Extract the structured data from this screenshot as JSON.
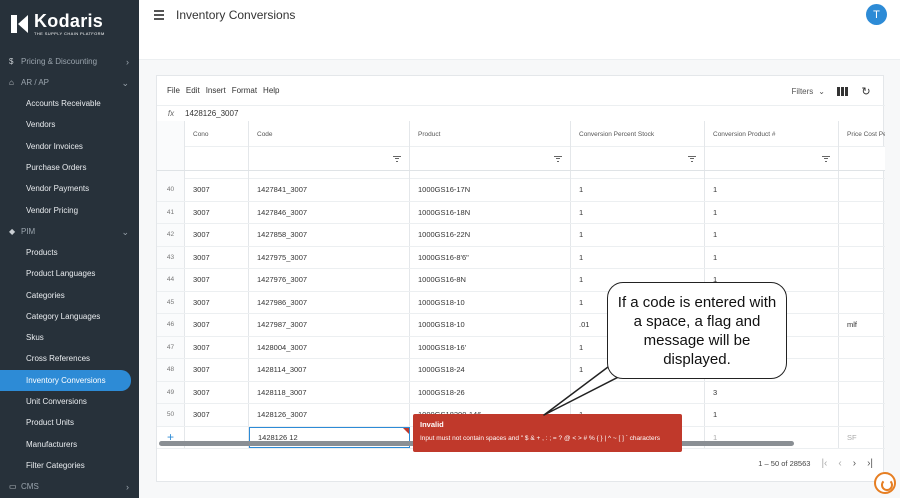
{
  "brand": {
    "name": "Kodaris",
    "tagline": "THE SUPPLY CHAIN PLATFORM"
  },
  "sidebar": {
    "items": [
      {
        "type": "group",
        "icon": "dollar-icon",
        "glyph": "$",
        "label": "Pricing & Discounting",
        "chevron": "›"
      },
      {
        "type": "group",
        "icon": "bank-icon",
        "glyph": "⌂",
        "label": "AR / AP",
        "chevron": "⌄"
      },
      {
        "type": "item",
        "label": "Accounts Receivable"
      },
      {
        "type": "item",
        "label": "Vendors"
      },
      {
        "type": "item",
        "label": "Vendor Invoices"
      },
      {
        "type": "item",
        "label": "Purchase Orders"
      },
      {
        "type": "item",
        "label": "Vendor Payments"
      },
      {
        "type": "item",
        "label": "Vendor Pricing"
      },
      {
        "type": "group",
        "icon": "tag-icon",
        "glyph": "◆",
        "label": "PIM",
        "chevron": "⌄"
      },
      {
        "type": "item",
        "label": "Products"
      },
      {
        "type": "item",
        "label": "Product Languages"
      },
      {
        "type": "item",
        "label": "Categories"
      },
      {
        "type": "item",
        "label": "Category Languages"
      },
      {
        "type": "item",
        "label": "Skus"
      },
      {
        "type": "item",
        "label": "Cross References"
      },
      {
        "type": "item",
        "label": "Inventory Conversions",
        "active": true
      },
      {
        "type": "item",
        "label": "Unit Conversions"
      },
      {
        "type": "item",
        "label": "Product Units"
      },
      {
        "type": "item",
        "label": "Manufacturers"
      },
      {
        "type": "item",
        "label": "Filter Categories"
      },
      {
        "type": "group",
        "icon": "cms-icon",
        "glyph": "▭",
        "label": "CMS",
        "chevron": "›"
      }
    ]
  },
  "header": {
    "title": "Inventory Conversions",
    "avatar_initial": "T"
  },
  "menubar": [
    "File",
    "Edit",
    "Insert",
    "Format",
    "Help"
  ],
  "toolbar": {
    "filters_label": "Filters",
    "filters_chevron": "⌄",
    "refresh_glyph": "↻"
  },
  "formula_bar": {
    "fx": "fx",
    "value": "1428126_3007"
  },
  "columns": [
    "Cono",
    "Code",
    "Product",
    "Conversion Percent Stock",
    "Conversion Product #",
    "Price Cost Per"
  ],
  "rows": [
    {
      "num": "40",
      "cono": "3007",
      "code": "1427841_3007",
      "product": "1000GS16-17N",
      "pct": "1",
      "conv": "1",
      "price": ""
    },
    {
      "num": "41",
      "cono": "3007",
      "code": "1427846_3007",
      "product": "1000GS16-18N",
      "pct": "1",
      "conv": "1",
      "price": ""
    },
    {
      "num": "42",
      "cono": "3007",
      "code": "1427858_3007",
      "product": "1000GS16-22N",
      "pct": "1",
      "conv": "1",
      "price": ""
    },
    {
      "num": "43",
      "cono": "3007",
      "code": "1427975_3007",
      "product": "1000GS16-8'6\"",
      "pct": "1",
      "conv": "1",
      "price": ""
    },
    {
      "num": "44",
      "cono": "3007",
      "code": "1427976_3007",
      "product": "1000GS16-8N",
      "pct": "1",
      "conv": "1",
      "price": ""
    },
    {
      "num": "45",
      "cono": "3007",
      "code": "1427986_3007",
      "product": "1000GS18-10",
      "pct": "1",
      "conv": "",
      "price": ""
    },
    {
      "num": "46",
      "cono": "3007",
      "code": "1427987_3007",
      "product": "1000GS18-10",
      "pct": ".01",
      "conv": "",
      "price": "mlf"
    },
    {
      "num": "47",
      "cono": "3007",
      "code": "1428004_3007",
      "product": "1000GS18-16'",
      "pct": "1",
      "conv": "",
      "price": ""
    },
    {
      "num": "48",
      "cono": "3007",
      "code": "1428114_3007",
      "product": "1000GS18-24",
      "pct": "1",
      "conv": "",
      "price": ""
    },
    {
      "num": "49",
      "cono": "3007",
      "code": "1428118_3007",
      "product": "1000GS18-26",
      "pct": "1",
      "conv": "3",
      "price": ""
    },
    {
      "num": "50",
      "cono": "3007",
      "code": "1428126_3007",
      "product": "1000GS18200-146",
      "pct": "1",
      "conv": "1",
      "price": ""
    }
  ],
  "new_row": {
    "add_glyph": "+",
    "code": "1428126 12",
    "conv": "1",
    "price": "SF"
  },
  "validation": {
    "title": "Invalid",
    "message": "Input must not contain spaces and \" $ & + , : ; = ? @ < > # % { } | ^ ~ [ ] ` characters"
  },
  "pagination": {
    "range": "1 – 50 of 28563",
    "first": "|‹",
    "prev": "‹",
    "next": "›",
    "last": "›|"
  },
  "callout": {
    "text": "If a code is entered with a space, a flag and message will be displayed."
  },
  "colors": {
    "sidebar_bg": "#27313a",
    "accent": "#2d8bd6",
    "error": "#c0392b",
    "chat": "#e67e22"
  }
}
